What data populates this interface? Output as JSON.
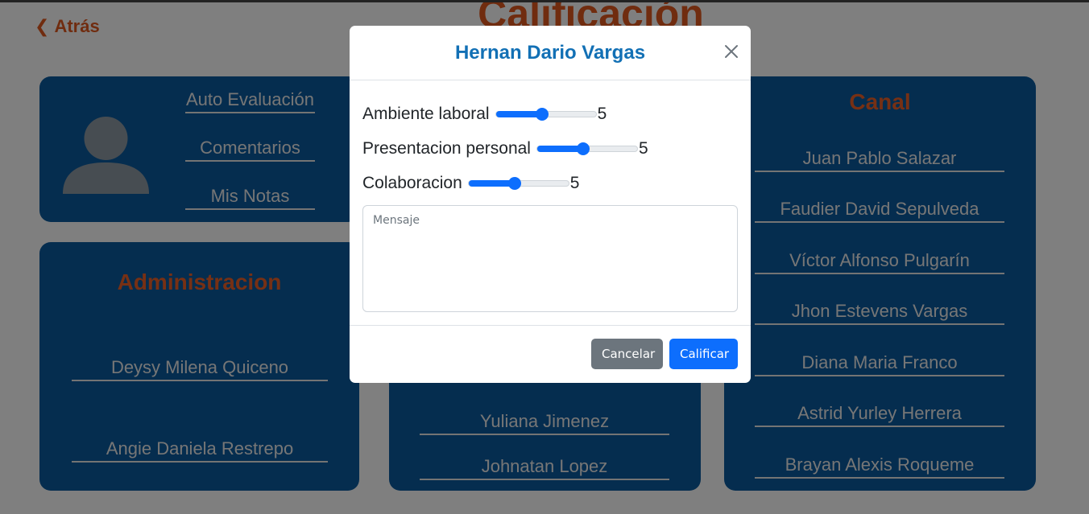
{
  "nav": {
    "back_label": "Atrás"
  },
  "page": {
    "title": "Calificación"
  },
  "profile": {
    "links": [
      "Auto Evaluación",
      "Comentarios",
      "Mis Notas"
    ]
  },
  "admin": {
    "title": "Administracion",
    "members": [
      "Deysy Milena Quiceno",
      "Angie Daniela Restrepo"
    ]
  },
  "middle": {
    "members": [
      "",
      "Yuliana Jimenez",
      "Johnatan Lopez"
    ]
  },
  "canal": {
    "title": "Canal",
    "members": [
      "Juan Pablo Salazar",
      "Faudier David Sepulveda",
      "Víctor Alfonso Pulgarín",
      "Jhon Estevens Vargas",
      "Diana Maria Franco",
      "Astrid Yurley Herrera",
      "Brayan Alexis Roqueme"
    ]
  },
  "modal": {
    "title": "Hernan Dario Vargas",
    "criteria": [
      {
        "label": "Ambiente laboral",
        "value": "5",
        "fraction": 0.46
      },
      {
        "label": "Presentacion personal",
        "value": "5",
        "fraction": 0.46
      },
      {
        "label": "Colaboracion",
        "value": "5",
        "fraction": 0.46
      }
    ],
    "message_placeholder": "Mensaje",
    "cancel_label": "Cancelar",
    "submit_label": "Calificar"
  },
  "colors": {
    "accent": "#e0581f",
    "card": "#0b5a9e",
    "modal_title": "#1270b5",
    "primary": "#0d6efd",
    "secondary": "#6c757d"
  }
}
